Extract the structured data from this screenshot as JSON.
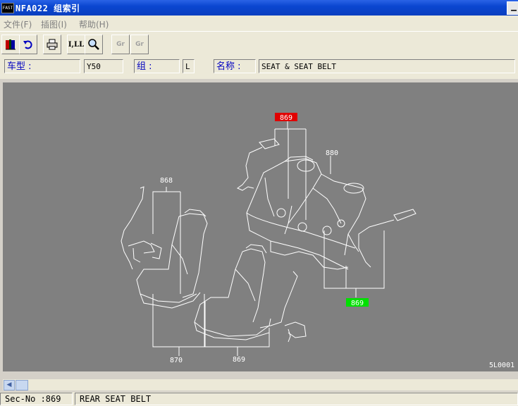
{
  "window": {
    "title": "NFA022 组索引",
    "app_icon_text": "FAST"
  },
  "menu": [
    {
      "label": "文件(F)"
    },
    {
      "label": "插图(I)"
    },
    {
      "label": "帮助(H)"
    }
  ],
  "toolbar": {
    "buttons": [
      {
        "name": "open-book-icon"
      },
      {
        "name": "undo-icon"
      },
      {
        "name": "print-icon"
      },
      {
        "name": "index-list-icon",
        "label": "I,LL"
      },
      {
        "name": "zoom-icon"
      },
      {
        "name": "prev-group-icon",
        "label": "Gr"
      },
      {
        "name": "next-group-icon",
        "label": "Gr"
      }
    ]
  },
  "fields": {
    "model_label": "车型 :",
    "model_value": "Y50",
    "group_label": "组 :",
    "group_value": "L",
    "name_label": "名称 :",
    "name_value": "SEAT & SEAT BELT"
  },
  "diagram": {
    "callouts": {
      "c869_top": "869",
      "c880": "880",
      "c868": "868",
      "c869_green": "869",
      "c870": "870",
      "c869_bottom": "869"
    },
    "colors": {
      "highlight_red": "#e00000",
      "highlight_green": "#00e000",
      "background": "#808080",
      "line": "#ffffff"
    },
    "corner_code": "5L0001"
  },
  "status": {
    "sec_no": "Sec-No :869",
    "description": "REAR SEAT BELT"
  }
}
